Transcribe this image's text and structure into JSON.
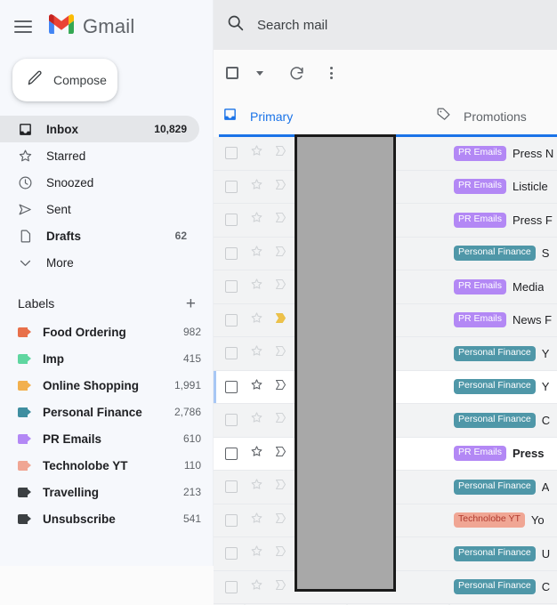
{
  "app": {
    "brand_name": "Gmail",
    "menu_icon": "hamburger-icon",
    "logo_icon": "gmail-m-logo"
  },
  "compose": {
    "label": "Compose",
    "icon": "pencil-icon"
  },
  "nav": {
    "items": [
      {
        "label": "Inbox",
        "count": "10,829",
        "icon": "inbox-icon",
        "selected": true
      },
      {
        "label": "Starred",
        "count": "",
        "icon": "star-icon",
        "selected": false
      },
      {
        "label": "Snoozed",
        "count": "",
        "icon": "clock-icon",
        "selected": false
      },
      {
        "label": "Sent",
        "count": "",
        "icon": "send-icon",
        "selected": false
      },
      {
        "label": "Drafts",
        "count": "62",
        "icon": "draft-icon",
        "selected": false
      },
      {
        "label": "More",
        "count": "",
        "icon": "chevron-down-icon",
        "selected": false
      }
    ]
  },
  "labels": {
    "title": "Labels",
    "add_icon": "plus-icon",
    "items": [
      {
        "label": "Food Ordering",
        "count": "982",
        "color": "#e8704a"
      },
      {
        "label": "Imp",
        "count": "415",
        "color": "#5fd6a0"
      },
      {
        "label": "Online Shopping",
        "count": "1,991",
        "color": "#f2b04e"
      },
      {
        "label": "Personal Finance",
        "count": "2,786",
        "color": "#3f8ea0"
      },
      {
        "label": "PR Emails",
        "count": "610",
        "color": "#b388f5"
      },
      {
        "label": "Technolobe YT",
        "count": "110",
        "color": "#f0a694"
      },
      {
        "label": "Travelling",
        "count": "213",
        "color": "#3c4043"
      },
      {
        "label": "Unsubscribe",
        "count": "541",
        "color": "#3c4043"
      }
    ]
  },
  "search": {
    "placeholder": "Search mail",
    "icon": "search-icon"
  },
  "toolbar": {
    "select_all_icon": "checkbox-icon",
    "select_caret_icon": "chevron-down-icon",
    "refresh_icon": "refresh-icon",
    "more_icon": "kebab-menu-icon"
  },
  "tabs": [
    {
      "label": "Primary",
      "icon": "inbox-icon",
      "active": true
    },
    {
      "label": "Promotions",
      "icon": "tag-icon",
      "active": false
    }
  ],
  "chip_colors": {
    "PR Emails": {
      "bg": "#b388f5",
      "fg": "#ffffff"
    },
    "Personal Finance": {
      "bg": "#4f97a8",
      "fg": "#ffffff"
    },
    "Technolobe YT": {
      "bg": "#f0a694",
      "fg": "#b03a2e"
    }
  },
  "emails": [
    {
      "chip": "PR Emails",
      "subject": "Press N",
      "unread": false,
      "important": false,
      "hover": false
    },
    {
      "chip": "PR Emails",
      "subject": "Listicle",
      "unread": false,
      "important": false,
      "hover": false
    },
    {
      "chip": "PR Emails",
      "subject": "Press F",
      "unread": false,
      "important": false,
      "hover": false
    },
    {
      "chip": "Personal Finance",
      "subject": "S",
      "unread": false,
      "important": false,
      "hover": false
    },
    {
      "chip": "PR Emails",
      "subject": "Media",
      "unread": false,
      "important": false,
      "hover": false
    },
    {
      "chip": "PR Emails",
      "subject": "News F",
      "unread": false,
      "important": true,
      "hover": false
    },
    {
      "chip": "Personal Finance",
      "subject": "Y",
      "unread": false,
      "important": false,
      "hover": false
    },
    {
      "chip": "Personal Finance",
      "subject": "Y",
      "unread": false,
      "important": false,
      "hover": true
    },
    {
      "chip": "Personal Finance",
      "subject": "C",
      "unread": false,
      "important": false,
      "hover": false
    },
    {
      "chip": "PR Emails",
      "subject": "Press",
      "unread": true,
      "important": false,
      "hover": false
    },
    {
      "chip": "Personal Finance",
      "subject": "A",
      "unread": false,
      "important": false,
      "hover": false
    },
    {
      "chip": "Technolobe YT",
      "subject": "Yo",
      "unread": false,
      "important": false,
      "hover": false
    },
    {
      "chip": "Personal Finance",
      "subject": "U",
      "unread": false,
      "important": false,
      "hover": false
    },
    {
      "chip": "Personal Finance",
      "subject": "C",
      "unread": false,
      "important": false,
      "hover": false
    }
  ],
  "redaction": {
    "name": "redaction-overlay"
  }
}
